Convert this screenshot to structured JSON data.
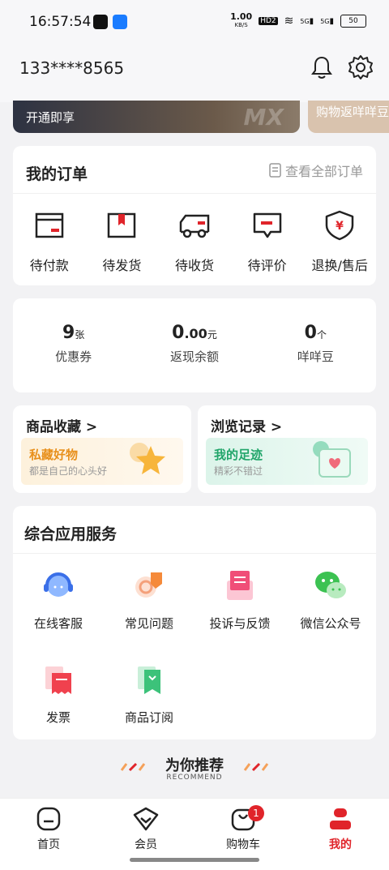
{
  "status": {
    "time": "16:57:54",
    "net_speed": "1.00",
    "net_unit": "KB/S",
    "hd": "HD2",
    "sig1": "5G",
    "sig2": "5G",
    "battery": "50"
  },
  "header": {
    "phone": "133****8565"
  },
  "banner": {
    "left_label": "开通即享",
    "left_mark": "MX",
    "right_label": "购物返咩咩豆"
  },
  "orders": {
    "title": "我的订单",
    "view_all": "查看全部订单",
    "items": [
      {
        "label": "待付款"
      },
      {
        "label": "待发货"
      },
      {
        "label": "待收货"
      },
      {
        "label": "待评价"
      },
      {
        "label": "退换/售后"
      }
    ]
  },
  "assets": [
    {
      "value": "9",
      "unit": "张",
      "label": "优惠券"
    },
    {
      "value": "0",
      "decimal": ".00",
      "unit": "元",
      "label": "返现余额"
    },
    {
      "value": "0",
      "unit": "个",
      "label": "咩咩豆"
    }
  ],
  "favorites": {
    "title": "商品收藏 >",
    "headline": "私藏好物",
    "sub": "都是自己的心头好"
  },
  "history": {
    "title": "浏览记录 >",
    "headline": "我的足迹",
    "sub": "精彩不错过"
  },
  "services": {
    "title": "综合应用服务",
    "items": [
      {
        "label": "在线客服",
        "icon": "headset-icon"
      },
      {
        "label": "常见问题",
        "icon": "question-icon"
      },
      {
        "label": "投诉与反馈",
        "icon": "feedback-icon"
      },
      {
        "label": "微信公众号",
        "icon": "wechat-icon"
      },
      {
        "label": "发票",
        "icon": "invoice-icon"
      },
      {
        "label": "商品订阅",
        "icon": "subscribe-icon"
      }
    ]
  },
  "recommend": {
    "title": "为你推荐",
    "subtitle": "RECOMMEND"
  },
  "tabbar": {
    "items": [
      {
        "label": "首页"
      },
      {
        "label": "会员"
      },
      {
        "label": "购物车",
        "badge": "1"
      },
      {
        "label": "我的"
      }
    ]
  },
  "colors": {
    "accent": "#e0242a",
    "fav": "#e8901c",
    "hist": "#21a56a"
  }
}
